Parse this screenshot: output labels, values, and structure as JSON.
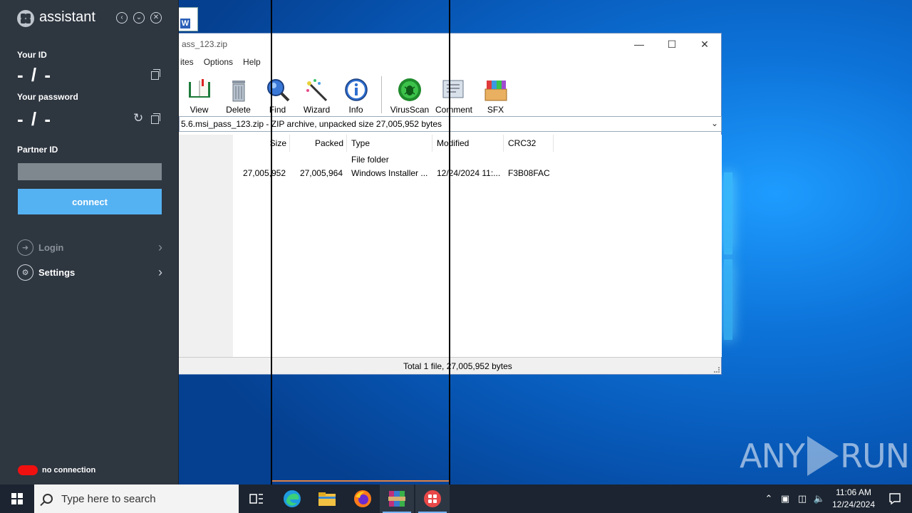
{
  "assistant": {
    "title": "assistant",
    "your_id_label": "Your ID",
    "your_id_value": "- / -",
    "your_password_label": "Your password",
    "your_password_value": "- / -",
    "partner_id_label": "Partner ID",
    "partner_id_value": "",
    "connect_label": "connect",
    "login_label": "Login",
    "settings_label": "Settings",
    "status_text": "no connection",
    "status_color": "#f01010",
    "accent_color": "#55b2f2"
  },
  "winrar": {
    "title_fragment": "ass_123.zip",
    "menu": [
      "ites",
      "Options",
      "Help"
    ],
    "toolbar": [
      "View",
      "Delete",
      "Find",
      "Wizard",
      "Info",
      "VirusScan",
      "Comment",
      "SFX"
    ],
    "path": "5.6.msi_pass_123.zip - ZIP archive, unpacked size 27,005,952 bytes",
    "columns": [
      "Size",
      "Packed",
      "Type",
      "Modified",
      "CRC32"
    ],
    "rows": [
      {
        "size": "",
        "packed": "",
        "type": "File folder",
        "modified": "",
        "crc": ""
      },
      {
        "size": "27,005,952",
        "packed": "27,005,964",
        "type": "Windows Installer ...",
        "modified": "12/24/2024 11:...",
        "crc": "F3B08FAC"
      }
    ],
    "status": "Total 1 file, 27,005,952 bytes"
  },
  "taskbar": {
    "search_placeholder": "Type here to search",
    "time": "11:06 AM",
    "date": "12/24/2024"
  },
  "watermark": "ANY RUN"
}
